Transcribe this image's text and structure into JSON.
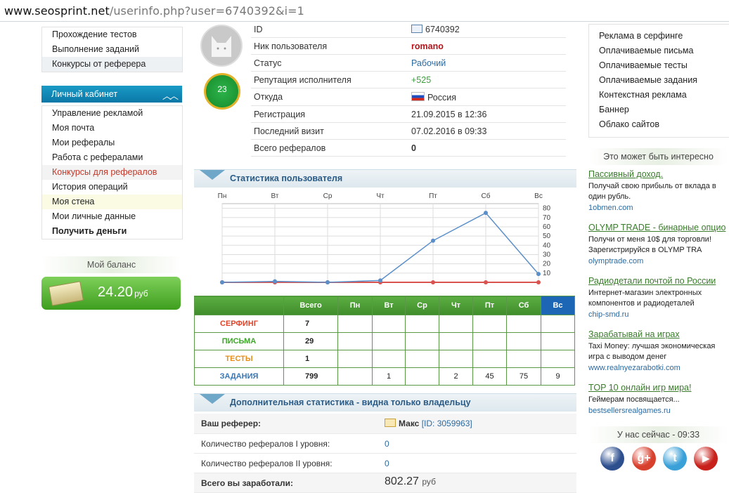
{
  "browser": {
    "url_host": "www.seosprint.net",
    "url_path": "/userinfo.php?user=6740392&i=1"
  },
  "left": {
    "top_items": [
      "Прохождение тестов",
      "Выполнение заданий",
      "Конкурсы от реферера"
    ],
    "cabinet_title": "Личный кабинет",
    "cabinet_items": [
      "Управление рекламой",
      "Моя почта",
      "Мои рефералы",
      "Работа с рефералами",
      "Конкурсы для рефералов",
      "История операций",
      "Моя стена",
      "Мои личные данные",
      "Получить деньги"
    ],
    "balance_title": "Мой баланс",
    "balance_amount": "24.20",
    "balance_currency": "руб"
  },
  "profile": {
    "level": "23",
    "rows": [
      {
        "key": "ID",
        "value": "6740392"
      },
      {
        "key": "Ник пользователя",
        "value": "romano"
      },
      {
        "key": "Статус",
        "value": "Рабочий"
      },
      {
        "key": "Репутация исполнителя",
        "value": "+525"
      },
      {
        "key": "Откуда",
        "value": "Россия"
      },
      {
        "key": "Регистрация",
        "value": "21.09.2015 в 12:36"
      },
      {
        "key": "Последний визит",
        "value": "07.02.2016 в 09:33"
      },
      {
        "key": "Всего рефералов",
        "value": "0"
      }
    ]
  },
  "stats": {
    "section_title": "Статистика пользователя",
    "columns": [
      "Всего",
      "Пн",
      "Вт",
      "Ср",
      "Чт",
      "Пт",
      "Сб",
      "Вс"
    ],
    "rows": [
      {
        "cat": "СЕРФИНГ",
        "color": "#e0452b",
        "cells": [
          "7",
          "",
          "",
          "",
          "",
          "",
          "",
          ""
        ]
      },
      {
        "cat": "ПИСЬМА",
        "color": "#3ea52a",
        "cells": [
          "29",
          "",
          "",
          "",
          "",
          "",
          "",
          ""
        ]
      },
      {
        "cat": "ТЕСТЫ",
        "color": "#e58e1a",
        "cells": [
          "1",
          "",
          "",
          "",
          "",
          "",
          "",
          ""
        ]
      },
      {
        "cat": "ЗАДАНИЯ",
        "color": "#3c78b5",
        "cells": [
          "799",
          "",
          "1",
          "",
          "2",
          "45",
          "75",
          "9"
        ]
      }
    ]
  },
  "chart_data": {
    "type": "line",
    "categories": [
      "Пн",
      "Вт",
      "Ср",
      "Чт",
      "Пт",
      "Сб",
      "Вс"
    ],
    "series": [
      {
        "values": [
          0,
          0,
          0,
          0,
          0,
          0,
          0
        ],
        "color": "#d9534f"
      },
      {
        "values": [
          0,
          1,
          0,
          2,
          45,
          75,
          9
        ],
        "color": "#5b8fc9"
      }
    ],
    "yticks": [
      10,
      20,
      30,
      40,
      50,
      60,
      70,
      80
    ],
    "ylim": [
      0,
      85
    ]
  },
  "additional": {
    "section_title": "Дополнительная статистика - видна только владельцу",
    "referer_label": "Ваш реферер:",
    "referer_name": "Макс",
    "referer_id": "[ID: 3059963]",
    "rows": [
      {
        "key": "Количество рефералов I уровня:",
        "value": "0"
      },
      {
        "key": "Количество рефералов II уровня:",
        "value": "0"
      }
    ],
    "earned_label": "Всего вы заработали:",
    "earned_value": "802.27",
    "earned_currency": "руб"
  },
  "right": {
    "menu": [
      "Реклама в серфинге",
      "Оплачиваемые письма",
      "Оплачиваемые тесты",
      "Оплачиваемые задания",
      "Контекстная реклама",
      "Баннер",
      "Облако сайтов"
    ],
    "interesting_title": "Это может быть интересно",
    "ads": [
      {
        "h": "Пассивный доход.",
        "d": "Получай свою прибыль от вклада в один рубль.",
        "s": "1obmen.com"
      },
      {
        "h": "OLYMP TRADE - бинарные опцио",
        "d": "Получи от меня 10$ для торговли! Зарегистрируйся в OLYMP TRA",
        "s": "olymptrade.com"
      },
      {
        "h": "Радиодетали почтой по России",
        "d": "Интернет-магазин электронных компонентов и радиодеталей",
        "s": "chip-smd.ru"
      },
      {
        "h": "Зарабатывай на играх",
        "d": "Taxi Money: лучшая экономическая игра с выводом денег",
        "s": "www.realnyezarabotki.com"
      },
      {
        "h": "TOP 10 онлайн игр мира!",
        "d": "Геймерам посвящается...",
        "s": "bestsellersrealgames.ru"
      }
    ],
    "now_title": "У нас сейчас - 09:33",
    "social": [
      {
        "icon": "facebook-icon",
        "glyph": "f",
        "color": "#2d4f8e"
      },
      {
        "icon": "google-plus-icon",
        "glyph": "g+",
        "color": "#d8402e"
      },
      {
        "icon": "twitter-icon",
        "glyph": "t",
        "color": "#3aa0d8"
      },
      {
        "icon": "youtube-icon",
        "glyph": "▶",
        "color": "#c8201a"
      }
    ]
  }
}
